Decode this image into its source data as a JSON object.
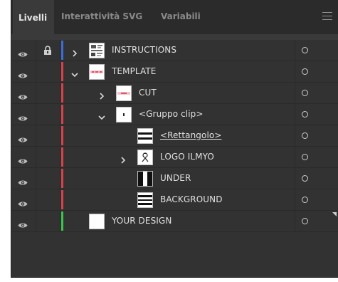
{
  "tabs": [
    {
      "label": "Livelli",
      "active": true
    },
    {
      "label": "Interattività SVG",
      "active": false
    },
    {
      "label": "Variabili",
      "active": false
    }
  ],
  "colors": {
    "blue_layer": "#3d6bd8",
    "red_layer": "#d8414a",
    "green_layer": "#39c44a",
    "panel_bg": "#323232"
  },
  "layers": [
    {
      "name": "INSTRUCTIONS",
      "indent": 0,
      "expanded": false,
      "locked": true,
      "color": "blue",
      "thumb": "instructions"
    },
    {
      "name": "TEMPLATE",
      "indent": 0,
      "expanded": true,
      "locked": false,
      "color": "red",
      "thumb": "template"
    },
    {
      "name": "CUT",
      "indent": 1,
      "expanded": false,
      "locked": false,
      "color": "red",
      "thumb": "cut"
    },
    {
      "name": "<Gruppo clip>",
      "indent": 1,
      "expanded": true,
      "locked": false,
      "color": "red",
      "thumb": "clip"
    },
    {
      "name": "<Rettangolo>",
      "indent": 2,
      "expanded": null,
      "locked": false,
      "color": "red",
      "thumb": "rect"
    },
    {
      "name": "LOGO ILMYO",
      "indent": 2,
      "expanded": false,
      "locked": false,
      "color": "red",
      "thumb": "logo"
    },
    {
      "name": "UNDER",
      "indent": 2,
      "expanded": null,
      "locked": false,
      "color": "red",
      "thumb": "under"
    },
    {
      "name": "BACKGROUND",
      "indent": 2,
      "expanded": null,
      "locked": false,
      "color": "red",
      "thumb": "background"
    },
    {
      "name": "YOUR DESIGN",
      "indent": 0,
      "expanded": null,
      "locked": false,
      "color": "green",
      "thumb": "blank"
    }
  ]
}
